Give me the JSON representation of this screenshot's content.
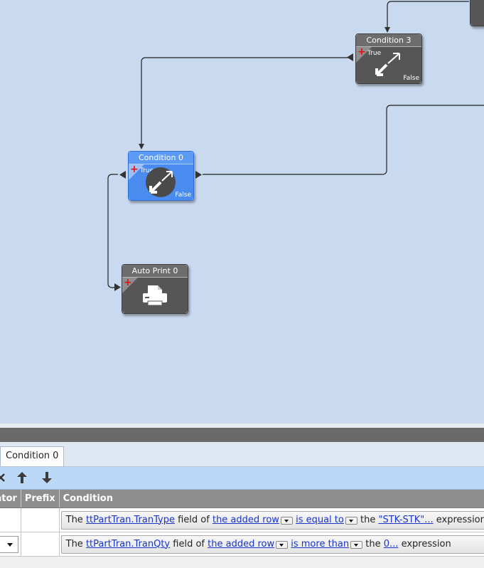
{
  "nodes": {
    "condition0": {
      "title": "Condition 0",
      "true_label": "True",
      "false_label": "False",
      "icon": "condition-arrows-icon",
      "selected": true
    },
    "condition3": {
      "title": "Condition 3",
      "true_label": "True",
      "false_label": "False",
      "icon": "condition-arrows-icon"
    },
    "autoprint0": {
      "title": "Auto Print 0",
      "icon": "printer-icon"
    }
  },
  "tabs": [
    {
      "label": "Condition 0",
      "active": true
    }
  ],
  "toolbar": {
    "icons": [
      "delete-icon",
      "move-up-icon",
      "move-down-icon"
    ]
  },
  "grid": {
    "columns": [
      "ator",
      "Prefix",
      "Condition"
    ],
    "rows": [
      {
        "text_the": "The",
        "field": "ttPartTran.TranType",
        "text_field_of": "field of",
        "row_ref": "the added row",
        "operator": "is equal to",
        "text_the2": "the",
        "value": "\"STK-STK\"...",
        "text_expression": "expression"
      },
      {
        "text_the": "The",
        "field": "ttPartTran.TranQty",
        "text_field_of": "field of",
        "row_ref": "the added row",
        "operator": "is more than",
        "text_the2": "the",
        "value": "0...",
        "text_expression": "expression"
      }
    ]
  },
  "colors": {
    "canvas": "#c9d9ef",
    "node_gray": "#565656",
    "node_blue": "#4a8bf0",
    "toolbar": "#bcd8f7",
    "link": "#1a35c8"
  }
}
